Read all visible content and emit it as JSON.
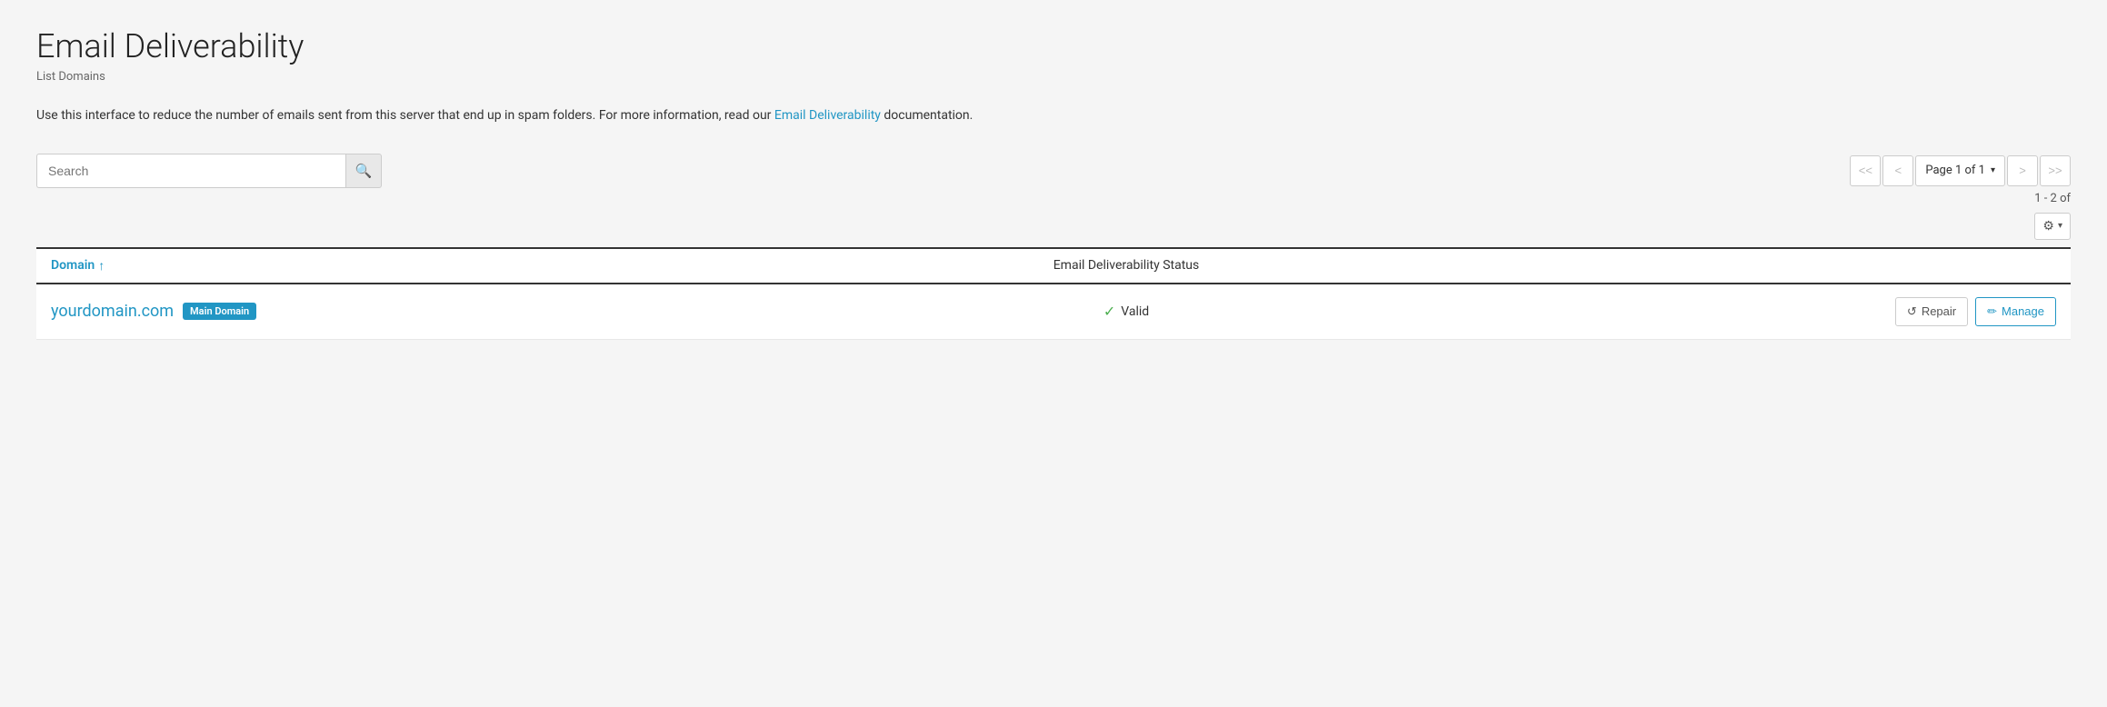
{
  "page": {
    "title": "Email Deliverability",
    "subtitle": "List Domains",
    "description_before_link": "Use this interface to reduce the number of emails sent from this server that end up in spam folders. For more information, read our ",
    "description_link_text": "Email Deliverability",
    "description_after_link": " documentation."
  },
  "search": {
    "placeholder": "Search",
    "button_icon": "🔍"
  },
  "pagination": {
    "first_label": "<<",
    "prev_label": "<",
    "page_label": "Page 1 of 1",
    "next_label": ">",
    "last_label": ">>",
    "results_text": "1 - 2 of"
  },
  "gear": {
    "icon": "⚙",
    "dropdown_icon": "▾"
  },
  "table": {
    "col_domain": "Domain",
    "col_domain_sort": "↑",
    "col_status": "Email Deliverability Status",
    "rows": [
      {
        "domain": "yourdomain.com",
        "badge": "Main Domain",
        "status": "Valid",
        "status_icon": "✓",
        "repair_label": "Repair",
        "repair_icon": "↺",
        "manage_label": "Manage",
        "manage_icon": "✏"
      }
    ]
  }
}
